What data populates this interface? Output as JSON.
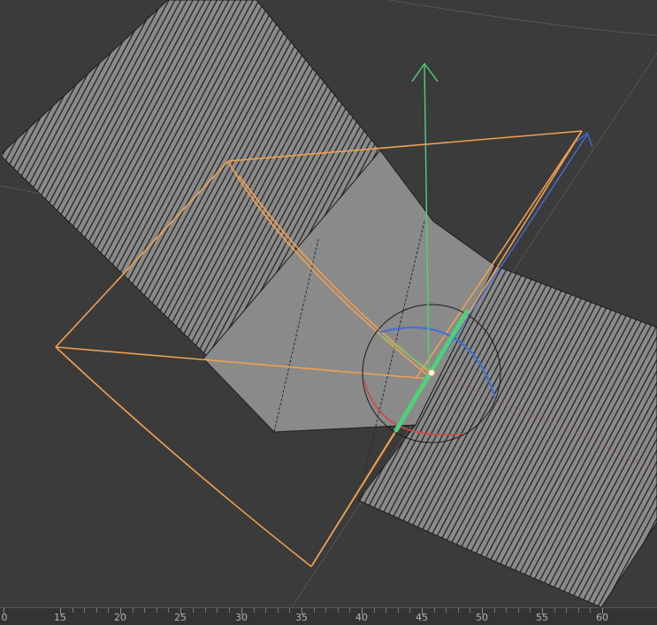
{
  "viewport": {
    "background_color": "#3b3b3b",
    "mesh_face_color": "#8a8a8a",
    "mesh_edge_color": "#1e1e1e",
    "cage_color": "#f0a050",
    "axis_colors": {
      "y": "#4fd07a",
      "z": "#3f6fd8",
      "x": "#d04848"
    }
  },
  "timeline": {
    "labels": [
      "0",
      "15",
      "20",
      "25",
      "30",
      "35",
      "40",
      "45",
      "50",
      "55",
      "60"
    ]
  }
}
